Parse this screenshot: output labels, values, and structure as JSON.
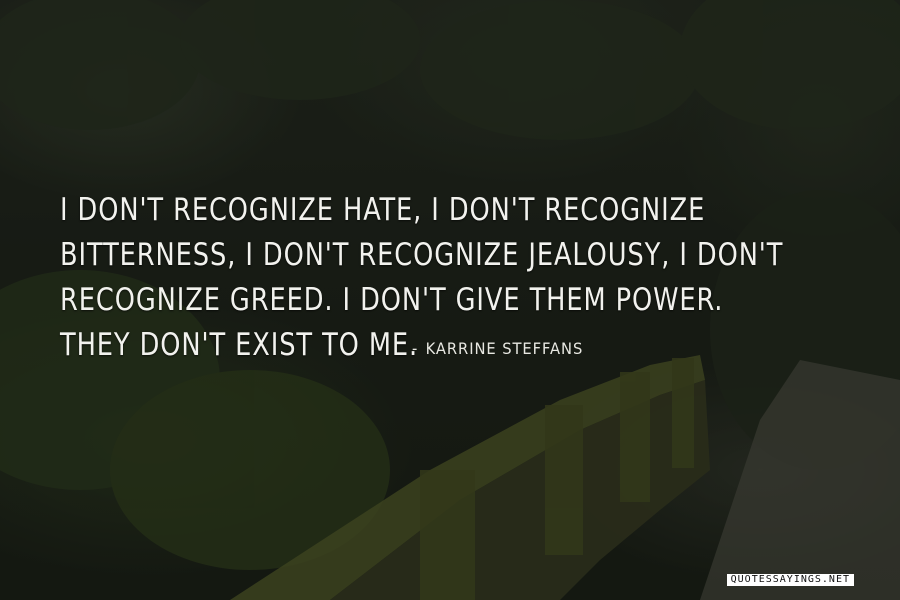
{
  "quote": {
    "text": "I don't recognize hate, I don't recognize bitterness, I don't recognize jealousy, I don't recognize greed. I don't give them power. They don't exist to me.",
    "author": "KARRINE STEFFANS",
    "author_prefix": "-"
  },
  "watermark": {
    "text": "QUOTESSAYINGS.NET"
  },
  "background": {
    "description_colors": {
      "foliage": "#2e3a24",
      "moss": "#5d6a2a",
      "stone": "#4a4a3e",
      "path": "#6b6a60"
    }
  }
}
